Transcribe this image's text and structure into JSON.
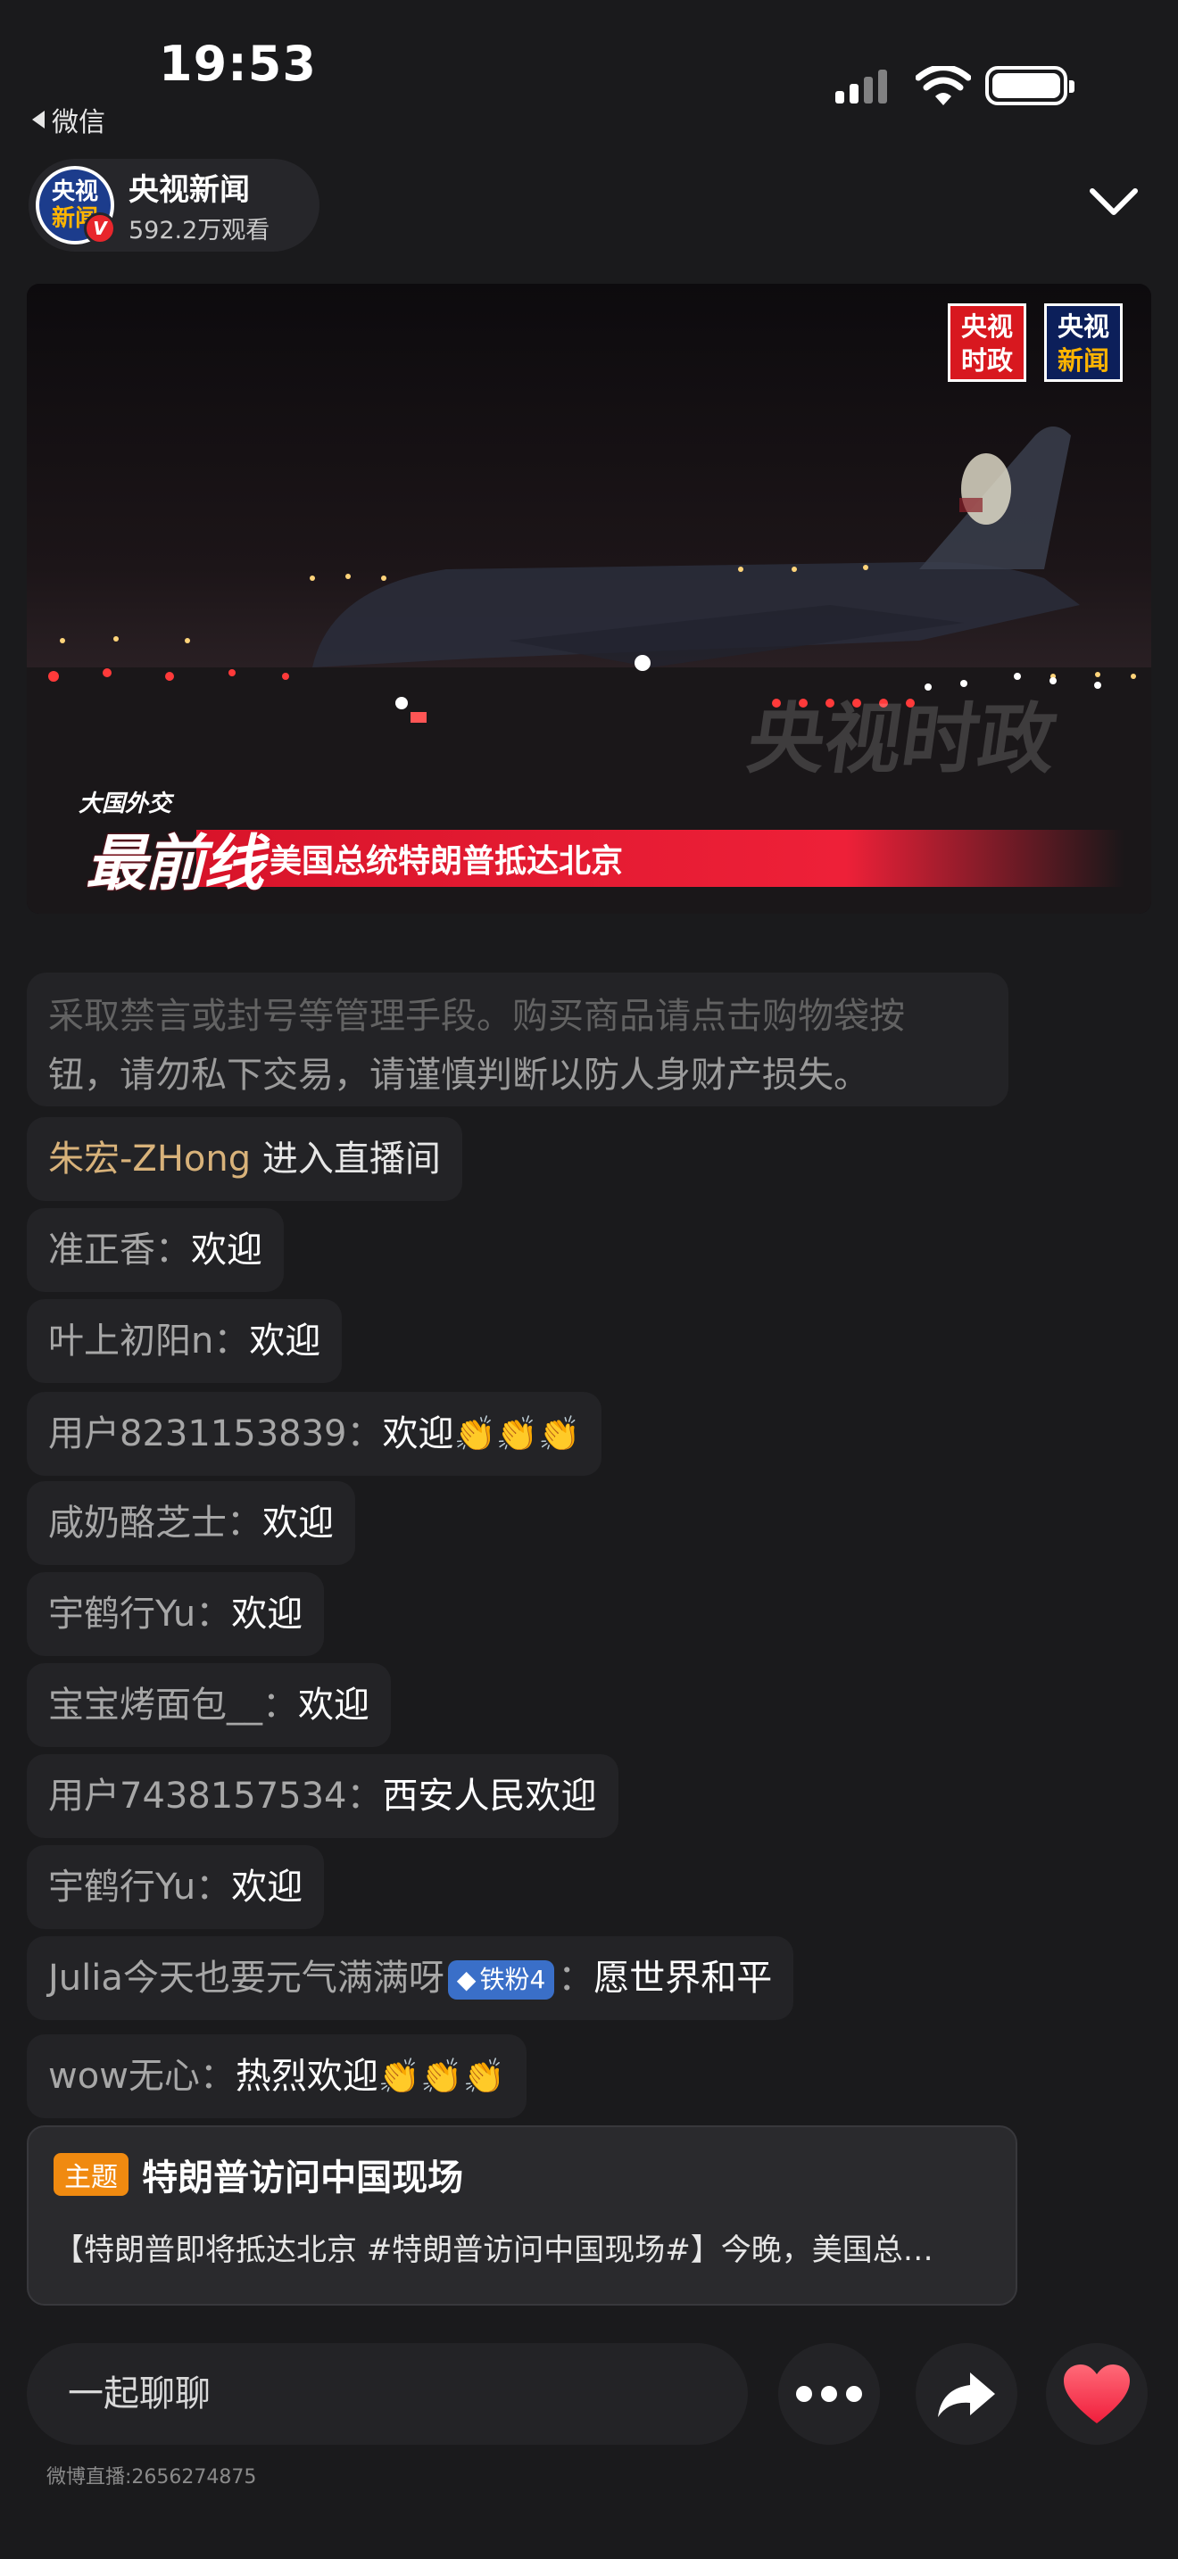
{
  "status": {
    "time": "19:53",
    "back_app": "微信"
  },
  "channel": {
    "avatar_line1": "央视",
    "avatar_line2": "新闻",
    "verified": "V",
    "name": "央视新闻",
    "views": "592.2万观看"
  },
  "video": {
    "logo1_line1": "央视",
    "logo1_line2": "时政",
    "logo2_line1": "央视",
    "logo2_line2": "新闻",
    "watermark": "央视时政",
    "badge_small": "大国外交",
    "badge_big": "最前线",
    "banner": "美国总统特朗普抵达北京"
  },
  "notice": {
    "line1": "采取禁言或封号等管理手段。购买商品请点击购物袋按",
    "line2": "钮，请勿私下交易，请谨慎判断以防人身财产损失。"
  },
  "enter": {
    "name": "朱宏-ZHong",
    "action": "进入直播间"
  },
  "comments": [
    {
      "nick": "准正香：",
      "msg": "欢迎",
      "claps": ""
    },
    {
      "nick": "叶上初阳n：",
      "msg": "欢迎",
      "claps": ""
    },
    {
      "nick": "用户8231153839：",
      "msg": "欢迎",
      "claps": "👏👏👏"
    },
    {
      "nick": "咸奶酪芝士：",
      "msg": "欢迎",
      "claps": ""
    },
    {
      "nick": "宇鹤行Yu：",
      "msg": "欢迎",
      "claps": ""
    },
    {
      "nick": "宝宝烤面包__：",
      "msg": "欢迎",
      "claps": ""
    },
    {
      "nick": "用户7438157534：",
      "msg": "西安人民欢迎",
      "claps": ""
    },
    {
      "nick": "宇鹤行Yu：",
      "msg": "欢迎",
      "claps": ""
    },
    {
      "nick": "Julia今天也要元气满满呀",
      "badge": "铁粉4",
      "sep": "：",
      "msg": "愿世界和平",
      "claps": ""
    },
    {
      "nick": "wow无心：",
      "msg": "热烈欢迎",
      "claps": "👏👏👏"
    }
  ],
  "topic": {
    "tag": "主题",
    "title": "特朗普访问中国现场",
    "desc": "【特朗普即将抵达北京 #特朗普访问中国现场#】今晚，美国总…"
  },
  "bottom": {
    "input_placeholder": "一起聊聊",
    "footer_id": "微博直播:2656274875"
  },
  "colors": {
    "background": "#1a1a1c",
    "bubble": "#232326",
    "banner_red": "#e41c30",
    "enter_name": "#d8b27a",
    "topic_tag": "#f08a10",
    "like_red": "#ff3b4e"
  }
}
